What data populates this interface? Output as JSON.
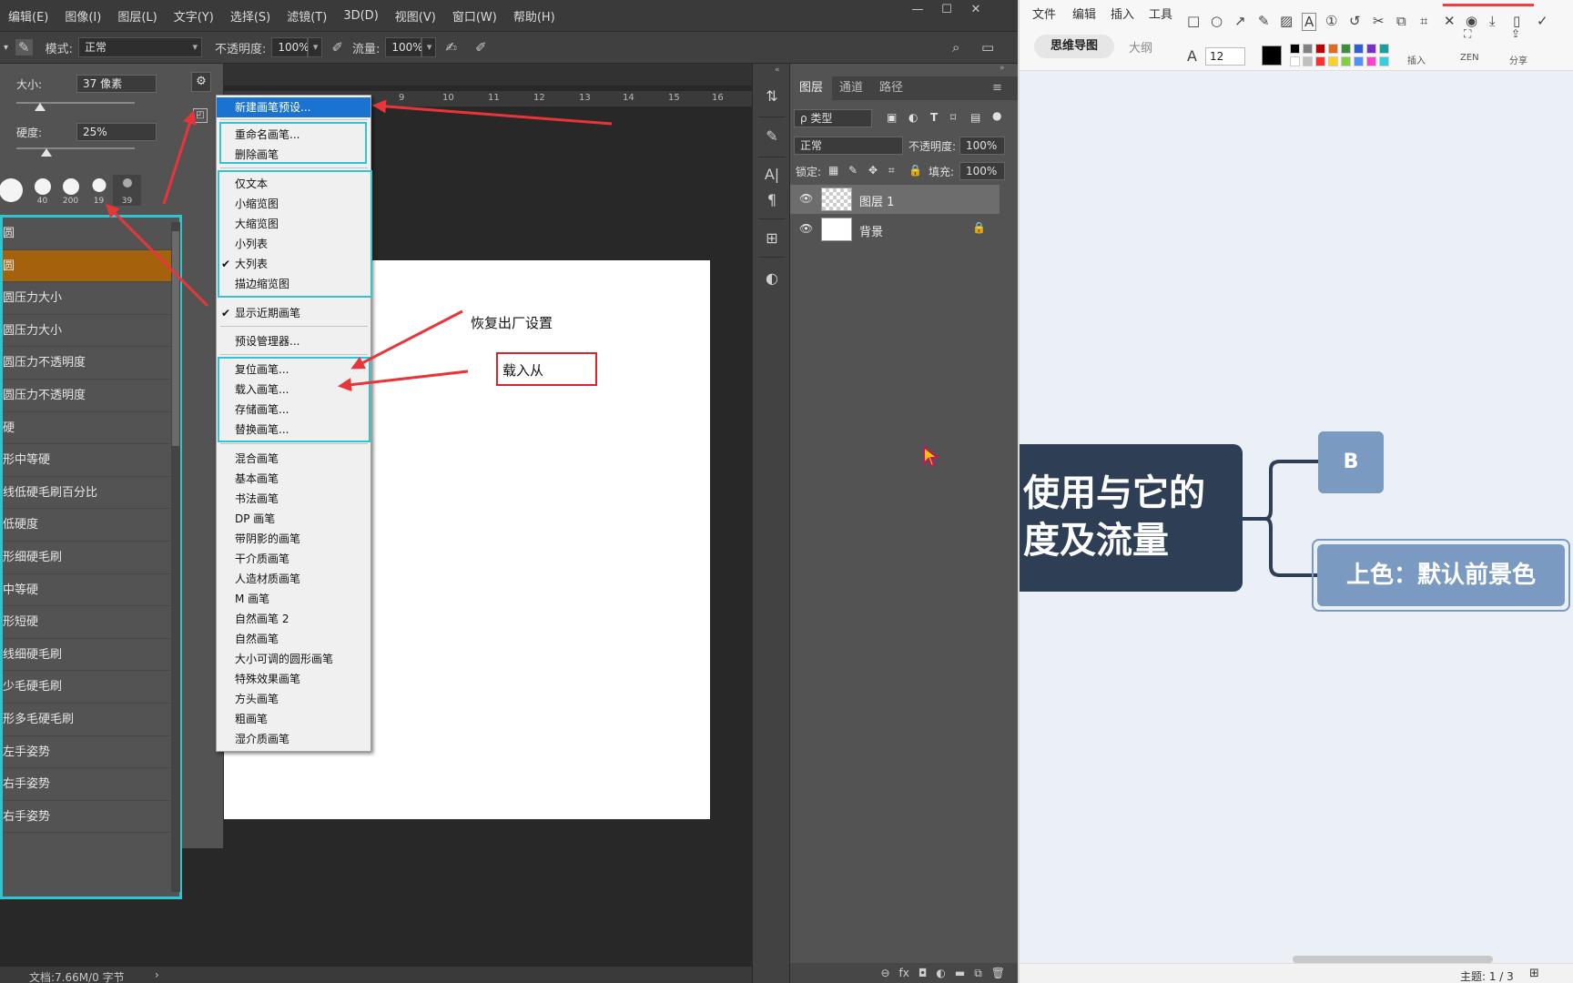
{
  "ps": {
    "menubar": [
      "编辑(E)",
      "图像(I)",
      "图层(L)",
      "文字(Y)",
      "选择(S)",
      "滤镜(T)",
      "3D(D)",
      "视图(V)",
      "窗口(W)",
      "帮助(H)"
    ],
    "window_controls": [
      "—",
      "☐",
      "✕"
    ],
    "options": {
      "mode_label": "模式:",
      "mode_value": "正常",
      "opacity_label": "不透明度:",
      "opacity_value": "100%",
      "flow_label": "流量:",
      "flow_value": "100%"
    },
    "brush_panel": {
      "size_label": "大小:",
      "size_value": "37 像素",
      "size_fraction": 0.2,
      "hardness_label": "硬度:",
      "hardness_value": "25%",
      "thumbs": [
        {
          "num": ""
        },
        {
          "num": "40"
        },
        {
          "num": "200"
        },
        {
          "num": "19"
        },
        {
          "num": "39"
        }
      ],
      "brushes": [
        "圆",
        "圆",
        "圆压力大小",
        "圆压力大小",
        "圆压力不透明度",
        "圆压力不透明度",
        "硬",
        "形中等硬",
        "线低硬毛刷百分比",
        "低硬度",
        "形细硬毛刷",
        "中等硬",
        "形短硬",
        "线细硬毛刷",
        "少毛硬毛刷",
        "形多毛硬毛刷",
        "左手姿势",
        "右手姿势",
        "右手姿势"
      ]
    },
    "ruler": [
      "9",
      "10",
      "11",
      "12",
      "13",
      "14",
      "15",
      "16"
    ],
    "status": "文档:7.66M/0 字节",
    "status_chevron": "›",
    "context_menu": {
      "new_preset": "新建画笔预设...",
      "rename": "重命名画笔...",
      "delete": "删除画笔",
      "view": [
        "仅文本",
        "小缩览图",
        "大缩览图",
        "小列表",
        "大列表",
        "描边缩览图"
      ],
      "check": "✔",
      "show_recent": "显示近期画笔",
      "preset_manager": "预设管理器...",
      "io": [
        "复位画笔...",
        "载入画笔...",
        "存储画笔...",
        "替换画笔..."
      ],
      "libraries": [
        "混合画笔",
        "基本画笔",
        "书法画笔",
        "DP 画笔",
        "带阴影的画笔",
        "干介质画笔",
        "人造材质画笔",
        "M 画笔",
        "自然画笔 2",
        "自然画笔",
        "大小可调的圆形画笔",
        "特殊效果画笔",
        "方头画笔",
        "粗画笔",
        "湿介质画笔"
      ]
    },
    "annotations": {
      "restore": "恢复出厂设置",
      "load_from": "载入从"
    },
    "layers": {
      "tabs": [
        "图层",
        "通道",
        "路径"
      ],
      "filter_label": "ρ 类型",
      "blend_mode": "正常",
      "opacity_label": "不透明度:",
      "opacity_value": "100%",
      "lock_label": "锁定:",
      "fill_label": "填充:",
      "fill_value": "100%",
      "items": [
        {
          "name": "图层 1"
        },
        {
          "name": "背景"
        }
      ],
      "bottom_icons": [
        "⊖",
        "fx",
        "◘",
        "◐",
        "▬",
        "⧉",
        "🗑"
      ]
    }
  },
  "mindmap": {
    "menu": [
      "文件",
      "编辑",
      "插入",
      "工具"
    ],
    "tabs": [
      "思维导图",
      "大纲"
    ],
    "font_glyph": "A",
    "font_size": "12",
    "captions": [
      "插入",
      "ZEN",
      "分享"
    ],
    "palette": [
      "#000000",
      "#808080",
      "#c00000",
      "#e06c20",
      "#3a8f3a",
      "#2f5fd0",
      "#7a2fc8",
      "#18a0a0",
      "#ffffff",
      "#c0c0c0",
      "#ff3030",
      "#ffd020",
      "#80d040",
      "#5090ff",
      "#ff40d0",
      "#30d0e0"
    ],
    "central_text": [
      "使用与它的",
      "度及流量"
    ],
    "node_b": "B",
    "node_color": "上色：默认前景色",
    "status": "主题: 1 / 3"
  }
}
